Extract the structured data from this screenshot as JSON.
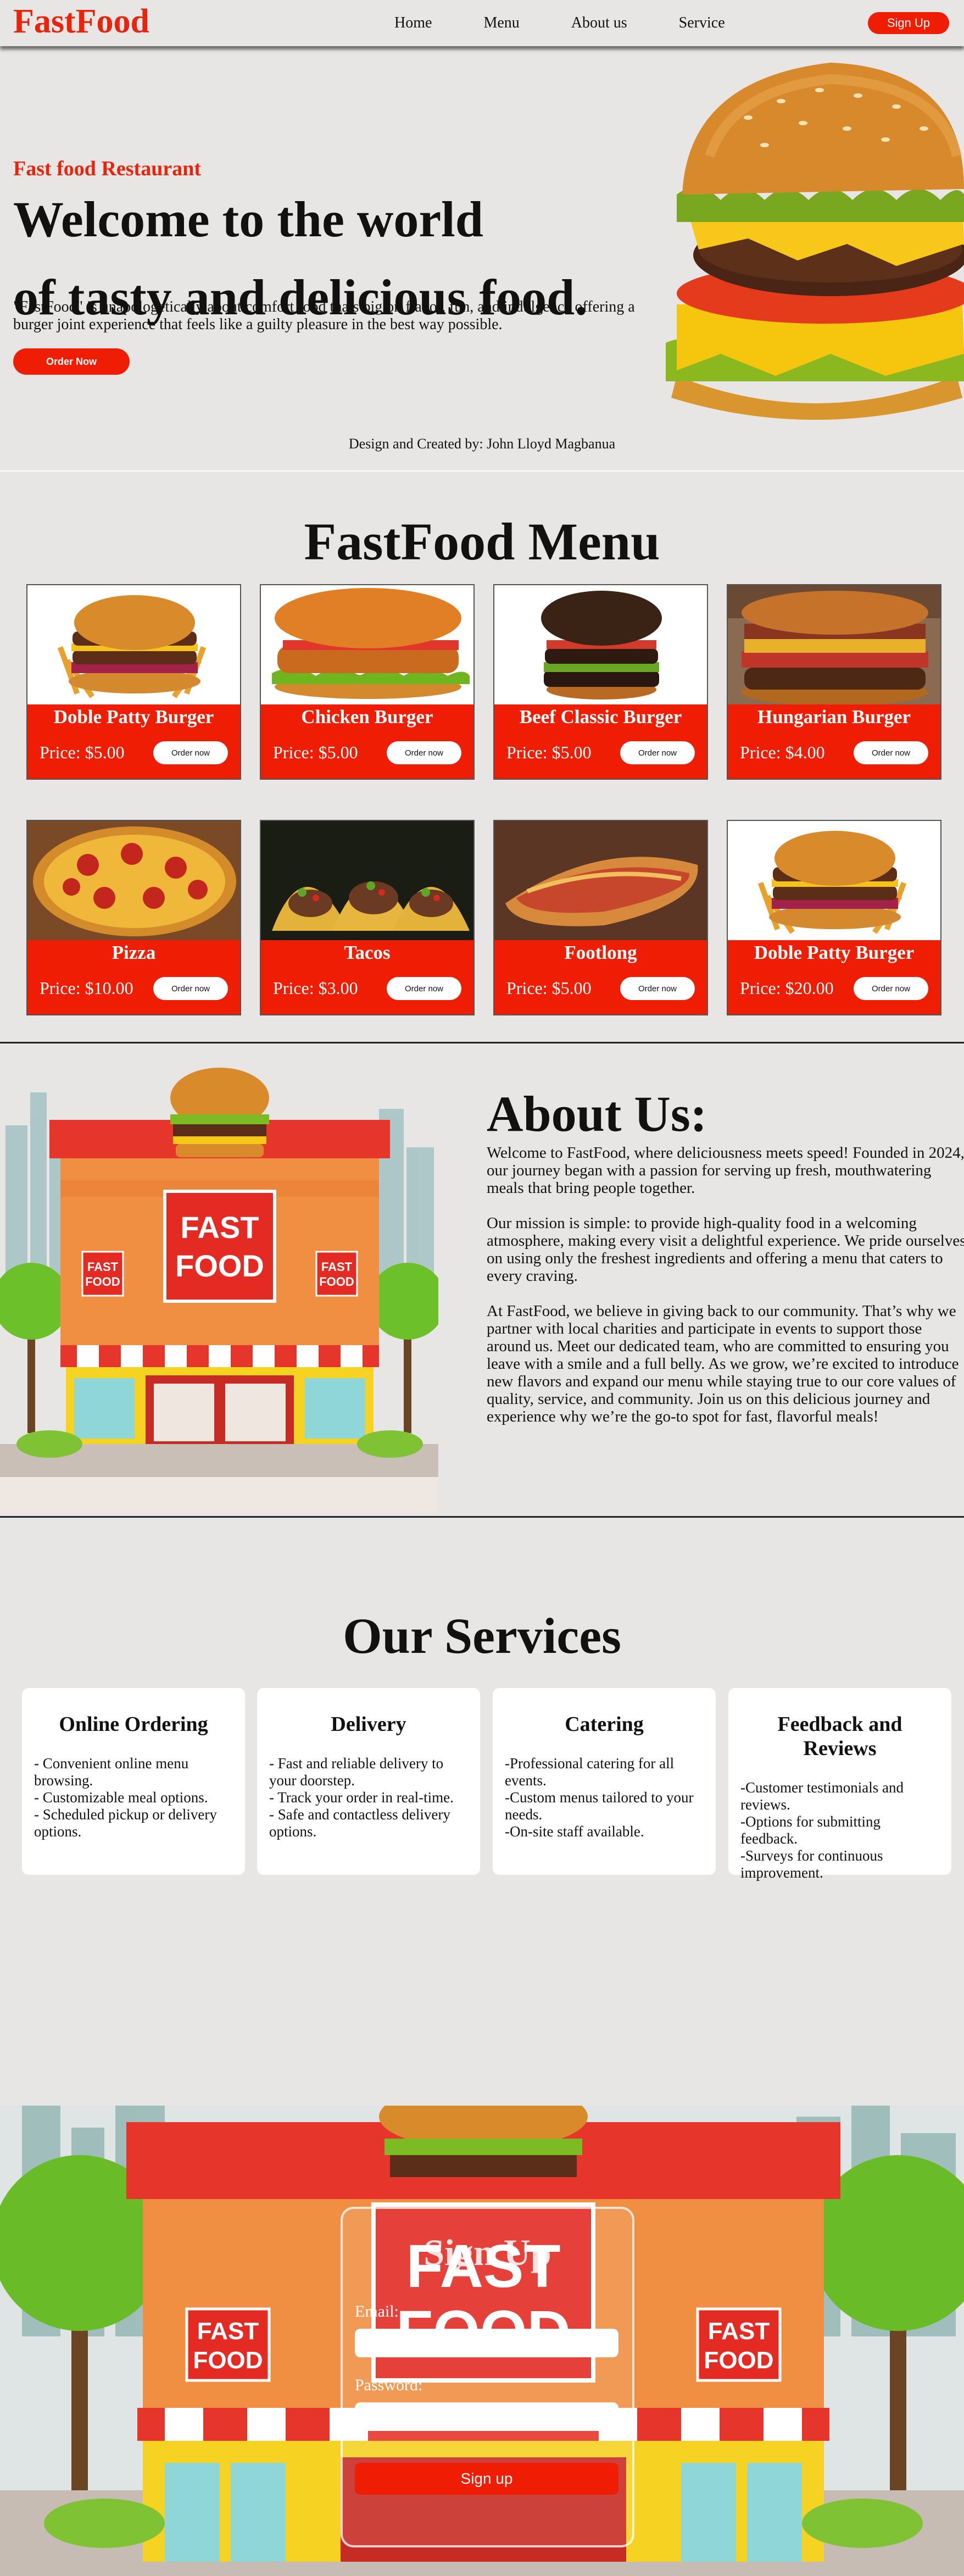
{
  "nav": {
    "logo": "FastFood",
    "links": [
      "Home",
      "Menu",
      "About us",
      "Service"
    ],
    "signup": "Sign Up"
  },
  "hero": {
    "subtitle": "Fast food Restaurant",
    "title_line1": "Welcome to the world",
    "title_line2": "of tasty and delicious food.",
    "description": "\"FastFood\" is unapologetically about comfort food thats big on flavor, fun, and indulgence offering a burger joint experience that feels like a guilty pleasure in the best way possible.",
    "order_button": "Order Now",
    "credit": "Design and Created by: John Lloyd Magbanua"
  },
  "menu": {
    "title": "FastFood Menu",
    "order_label": "Order now",
    "items": [
      {
        "name": "Doble Patty Burger",
        "price": "Price: $5.00",
        "pic": "burger-fries"
      },
      {
        "name": "Chicken Burger",
        "price": "Price: $5.00",
        "pic": "chicken-burger"
      },
      {
        "name": "Beef Classic Burger",
        "price": "Price: $5.00",
        "pic": "beef-burger"
      },
      {
        "name": "Hungarian Burger",
        "price": "Price: $4.00",
        "pic": "hungarian-burger"
      },
      {
        "name": "Pizza",
        "price": "Price: $10.00",
        "pic": "pizza"
      },
      {
        "name": "Tacos",
        "price": "Price: $3.00",
        "pic": "tacos"
      },
      {
        "name": "Footlong",
        "price": "Price: $5.00",
        "pic": "footlong"
      },
      {
        "name": "Doble Patty Burger",
        "price": "Price: $20.00",
        "pic": "burger-fries"
      }
    ]
  },
  "about": {
    "title": "About Us:",
    "p1": "Welcome to FastFood, where deliciousness meets speed! Founded in 2024, our journey began with a passion for serving up fresh, mouthwatering meals that bring people together.",
    "p2": "Our mission is simple: to provide high-quality food in a welcoming atmosphere, making every visit a delightful experience. We pride ourselves on using only the freshest ingredients and offering a menu that caters to every craving.",
    "p3": "At FastFood, we believe in giving back to our community. That’s why we partner with local charities and participate in events to support those around us. Meet our dedicated team, who are committed to ensuring you leave with a smile and a full belly. As we grow, we’re excited to introduce new flavors and expand our menu while staying true to our core values of quality, service, and community. Join us on this delicious journey and experience why we’re the go-to spot for fast, flavorful meals!",
    "store_sign_main": "FAST FOOD",
    "store_sign_side": "FAST FOOD"
  },
  "services": {
    "title": "Our Services",
    "items": [
      {
        "title": "Online Ordering",
        "body": "- Convenient online menu browsing.\n- Customizable meal options.\n- Scheduled pickup or delivery options."
      },
      {
        "title": "Delivery",
        "body": "- Fast and reliable delivery to your doorstep.\n- Track your order in real-time.\n- Safe and contactless delivery options."
      },
      {
        "title": "Catering",
        "body": "-Professional catering for all events.\n-Custom menus tailored to your needs.\n-On-site staff available."
      },
      {
        "title": "Feedback and Reviews",
        "body": "-Customer testimonials and reviews.\n-Options for submitting feedback.\n-Surveys for continuous improvement."
      }
    ]
  },
  "signup": {
    "title": "Sign Up",
    "email_label": "Email:",
    "password_label": "Password:",
    "email_value": "",
    "password_value": "",
    "button": "Sign up"
  },
  "colors": {
    "accent": "#ee1d04",
    "logo": "#e8240c",
    "background": "#e8e6e4"
  }
}
